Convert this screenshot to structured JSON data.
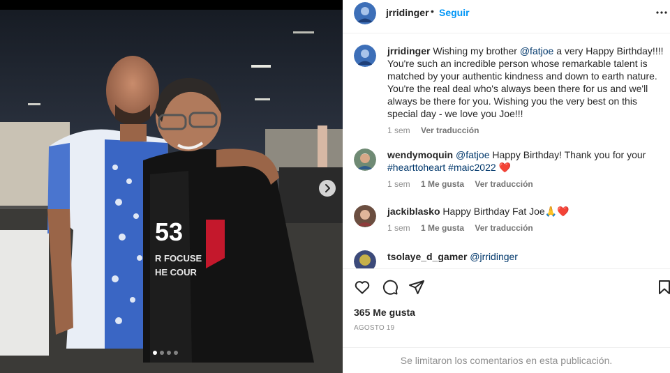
{
  "post": {
    "username": "jrridinger",
    "separator": "•",
    "follow_label": "Seguir",
    "caption": {
      "username": "jrridinger",
      "text_before": " Wishing my brother ",
      "mention": "@fatjoe",
      "text_after": " a very Happy Birthday!!!! You're such an incredible person whose remarkable talent is matched by your authentic kindness and down to earth nature. You're the real deal who's always been there for us and we'll always be there for you. Wishing you the very best on this special day - we love you Joe!!!",
      "time": "1 sem",
      "translate": "Ver traducción"
    }
  },
  "comments": [
    {
      "username": "wendymoquin",
      "mention": "@fatjoe",
      "text": " Happy Birthday! Thank you for your ",
      "hashtags": "#hearttoheart #maic2022",
      "emoji": "❤️",
      "time": "1 sem",
      "likes": "1 Me gusta",
      "translate": "Ver traducción"
    },
    {
      "username": "jackiblasko",
      "text": " Happy Birthday Fat Joe",
      "emoji": "🙏❤️",
      "time": "1 sem",
      "likes": "1 Me gusta",
      "translate": "Ver traducción"
    },
    {
      "username": "tsolaye_d_gamer",
      "mention": "@jrridinger"
    }
  ],
  "footer": {
    "likes": "365 Me gusta",
    "date": "AGOSTO 19",
    "comments_limited": "Se limitaron los comentarios en esta publicación."
  },
  "carousel": {
    "count": 4,
    "active": 0
  },
  "colors": {
    "link": "#00376b",
    "follow": "#0095f6",
    "heart": "#ed4956"
  }
}
